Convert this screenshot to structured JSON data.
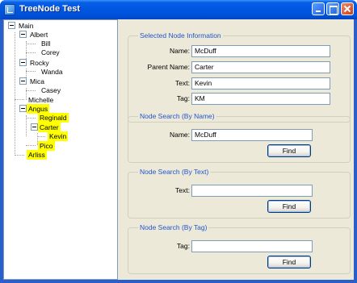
{
  "window": {
    "title": "TreeNode Test"
  },
  "tree": {
    "nodes": [
      {
        "label": "Main",
        "highlighted": false
      },
      {
        "label": "Albert",
        "highlighted": false
      },
      {
        "label": "Bill",
        "highlighted": false
      },
      {
        "label": "Corey",
        "highlighted": false
      },
      {
        "label": "Rocky",
        "highlighted": false
      },
      {
        "label": "Wanda",
        "highlighted": false
      },
      {
        "label": "Mica",
        "highlighted": false
      },
      {
        "label": "Casey",
        "highlighted": false
      },
      {
        "label": "Michelle",
        "highlighted": false
      },
      {
        "label": "Angus",
        "highlighted": true
      },
      {
        "label": "Reginald",
        "highlighted": true
      },
      {
        "label": "Carter",
        "highlighted": true
      },
      {
        "label": "Kevin",
        "highlighted": true
      },
      {
        "label": "Pico",
        "highlighted": true
      },
      {
        "label": "Arliss",
        "highlighted": true
      }
    ]
  },
  "selected_info": {
    "title": "Selected Node Information",
    "name_label": "Name:",
    "name_value": "McDuff",
    "parent_label": "Parent Name:",
    "parent_value": "Carter",
    "text_label": "Text:",
    "text_value": "Kevin",
    "tag_label": "Tag:",
    "tag_value": "KM"
  },
  "search_name": {
    "title": "Node Search (By Name)",
    "label": "Name:",
    "value": "McDuff",
    "button": "Find"
  },
  "search_text": {
    "title": "Node Search (By Text)",
    "label": "Text:",
    "value": "",
    "button": "Find"
  },
  "search_tag": {
    "title": "Node Search (By Tag)",
    "label": "Tag:",
    "value": "",
    "button": "Find"
  },
  "colors": {
    "highlight": "#ffff00",
    "title_bar": "#0055e5",
    "group_title": "#2255cc"
  }
}
